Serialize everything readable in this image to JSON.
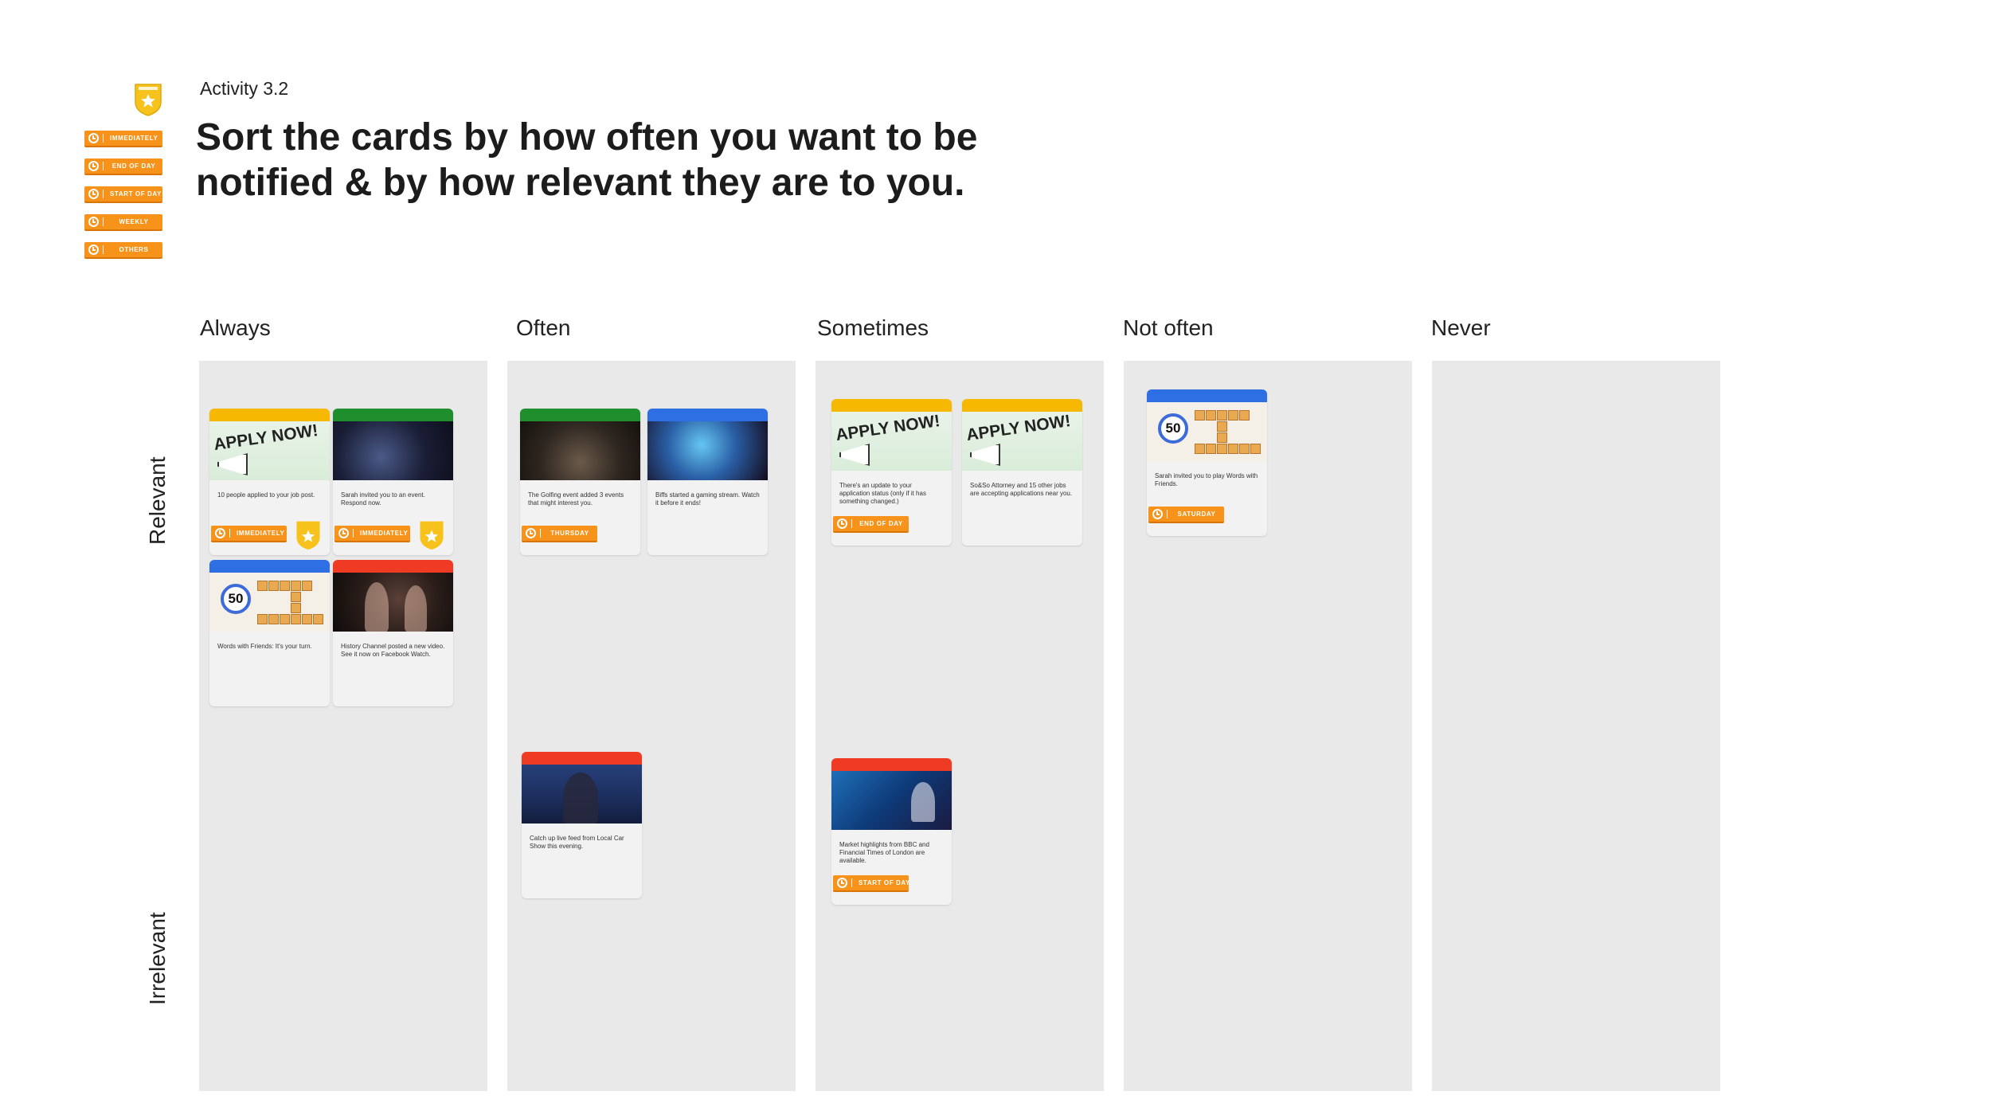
{
  "header": {
    "activity": "Activity 3.2",
    "title": "Sort the cards by how often you want to be notified & by how relevant they are to you."
  },
  "legend": [
    "Immediately",
    "End of day",
    "Start of day",
    "Weekly",
    "Others"
  ],
  "columns": [
    "Always",
    "Often",
    "Sometimes",
    "Not often",
    "Never"
  ],
  "rows": {
    "relevant": "Relevant",
    "irrelevant": "Irrelevant"
  },
  "cards": {
    "always_apply": {
      "text": "10 people applied to your job post.",
      "tag": "Immediately",
      "image": "APPLY NOW!"
    },
    "always_event": {
      "text": "Sarah invited you to an event. Respond now.",
      "tag": "Immediately"
    },
    "always_words": {
      "text": "Words with Friends: It's your turn."
    },
    "always_history": {
      "text": "History Channel posted a new video. See it now on Facebook Watch."
    },
    "often_golfing": {
      "text": "The Golfing event added 3 events that might interest you.",
      "tag": "Thursday"
    },
    "often_biffs": {
      "text": "Biffs started a gaming stream. Watch it before it ends!"
    },
    "often_carshow": {
      "text": "Catch up live feed from Local Car Show this evening."
    },
    "sometimes_update": {
      "text": "There's an update to your application status (only if it has something changed.)",
      "tag": "End of day",
      "image": "APPLY NOW!"
    },
    "sometimes_attorney": {
      "text": "So&So Attorney and 15 other jobs are accepting applications near you.",
      "image": "APPLY NOW!"
    },
    "sometimes_market": {
      "text": "Market highlights from BBC and Financial Times of London are available.",
      "tag": "Start of day"
    },
    "notoften_words": {
      "text": "Sarah invited you to play Words with Friends.",
      "tag": "Saturday"
    }
  },
  "colors": {
    "tag_orange": "#f7931a",
    "column_bg": "#e9e9e9",
    "bar_yellow": "#f6b800",
    "bar_green": "#1f8f2e",
    "bar_blue": "#2f6fe4",
    "bar_red": "#ef3b23",
    "badge_gold": "#f8c21c"
  }
}
